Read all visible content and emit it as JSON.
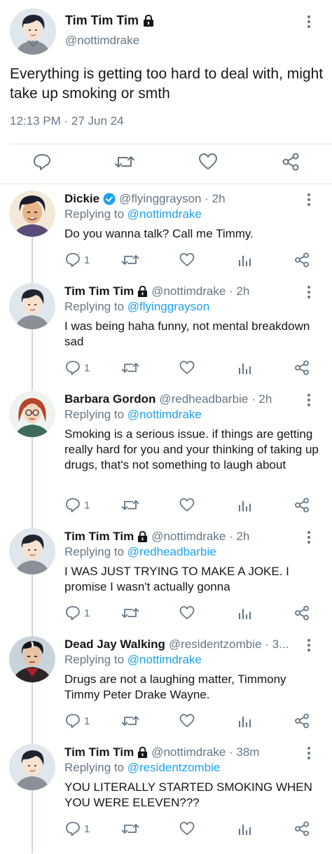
{
  "main_tweet": {
    "name": "Tim Tim Tim",
    "handle": "@nottimdrake",
    "text": "Everything is getting too hard to deal with, might take up smoking or smth",
    "timestamp": "12:13 PM · 27 Jun 24",
    "locked": true
  },
  "replies": [
    {
      "name": "Dickie",
      "verified": true,
      "locked": false,
      "handle": "@flyinggrayson · 2h",
      "replying_prefix": "Replying to",
      "replying_to": "@nottimdrake",
      "text": "Do you wanna talk? Call me Timmy.",
      "reply_count": "1"
    },
    {
      "name": "Tim Tim Tim",
      "verified": false,
      "locked": true,
      "handle": "@nottimdrake · 2h",
      "replying_prefix": "Replying to",
      "replying_to": "@flyinggrayson",
      "text": "I was being haha funny, not mental breakdown sad",
      "reply_count": "1"
    },
    {
      "name": "Barbara Gordon",
      "verified": false,
      "locked": false,
      "handle": "@redheadbarbie · 2h",
      "replying_prefix": "Replying to",
      "replying_to": "@nottimdrake",
      "text": "Smoking is a serious issue. if things are getting really hard for you and your thinking of taking up drugs, that's not something to laugh about",
      "reply_count": "1"
    },
    {
      "name": "Tim Tim Tim",
      "verified": false,
      "locked": true,
      "handle": "@nottimdrake · 2h",
      "replying_prefix": "Replying to",
      "replying_to": "@redheadbarbie",
      "text": "I WAS JUST TRYING TO MAKE A JOKE. I promise I wasn't actually gonna",
      "reply_count": "1"
    },
    {
      "name": "Dead Jay Walking",
      "verified": false,
      "locked": false,
      "handle": "@residentzombie · 3...",
      "replying_prefix": "Replying to",
      "replying_to": "@nottimdrake",
      "text": "Drugs are not a laughing matter, Timmony Timmy Peter Drake Wayne.",
      "reply_count": "1"
    },
    {
      "name": "Tim Tim Tim",
      "verified": false,
      "locked": true,
      "handle": "@nottimdrake · 38m",
      "replying_prefix": "Replying to",
      "replying_to": "@residentzombie",
      "text": "YOU LITERALLY STARTED SMOKING WHEN YOU WERE ELEVEN???",
      "reply_count": "1"
    }
  ],
  "colors": {
    "accent": "#1da1f2",
    "text": "#14171a",
    "muted": "#657786",
    "divider": "#e1e8ed",
    "thread_line": "#ccd6dd"
  },
  "icons": {
    "reply": "reply-icon",
    "retweet": "retweet-icon",
    "like": "heart-icon",
    "analytics": "analytics-icon",
    "share": "share-icon",
    "lock": "lock-icon",
    "verified": "verified-badge-icon",
    "more": "more-vertical-icon"
  }
}
